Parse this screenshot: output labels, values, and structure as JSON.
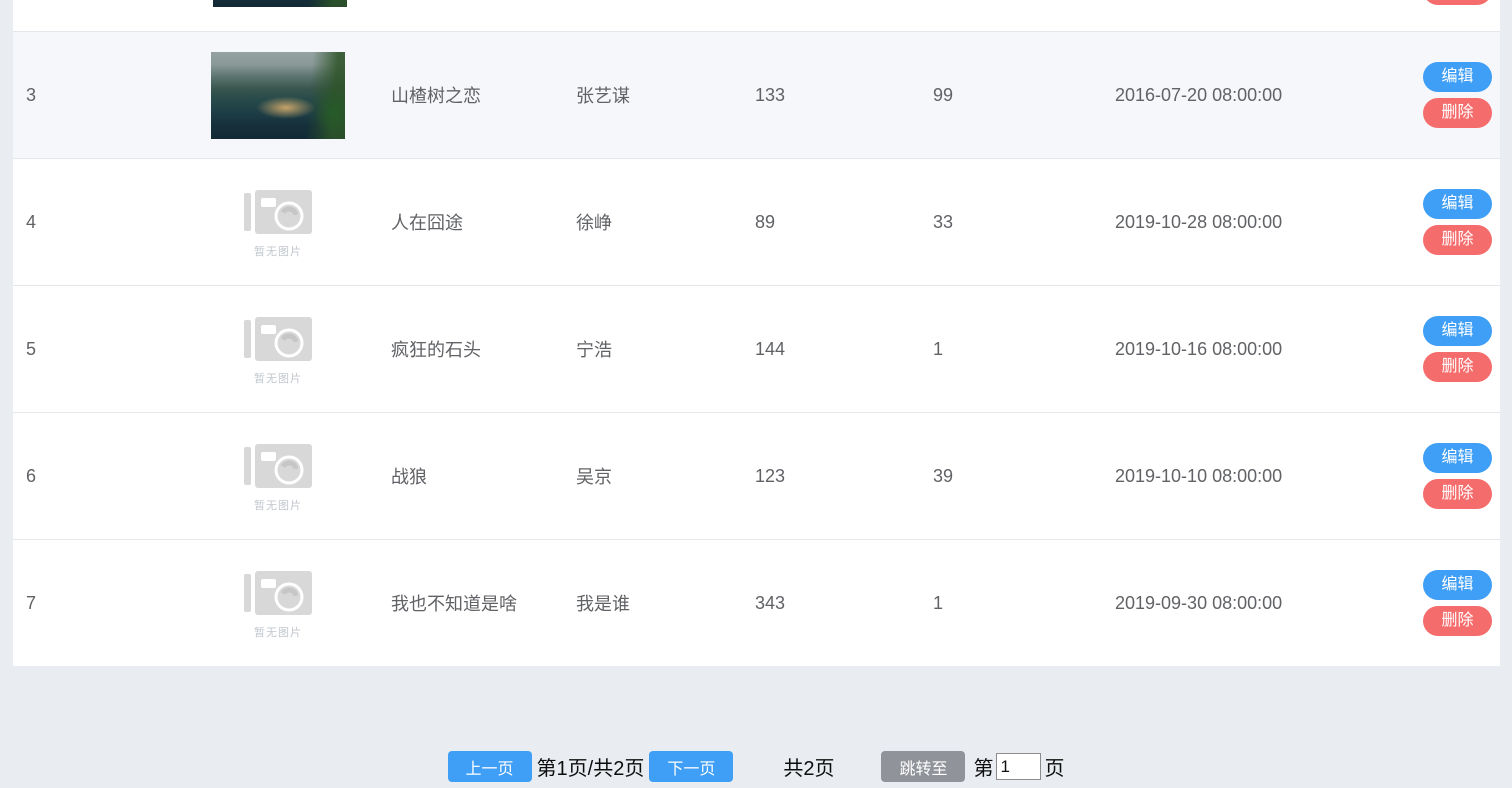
{
  "colors": {
    "page_bg": "#e9edf1",
    "table_bg": "#ffffff",
    "row_highlight_bg": "#f5f7fa",
    "row_border": "#e4e7ec",
    "cell_text": "#606266",
    "primary_blue": "#3f9ef5",
    "danger_red": "#f56c6c",
    "info_gray": "#909399",
    "placeholder_icon_gray": "#d8d8d8",
    "placeholder_text_gray": "#c2c7ce"
  },
  "icons": {
    "no_image": "camera-icon"
  },
  "image_placeholder_label": "暂无图片",
  "actions": {
    "edit_label": "编辑",
    "delete_label": "删除"
  },
  "table": {
    "rows": [
      {
        "id": "3",
        "title": "山楂树之恋",
        "director": "张艺谋",
        "num1": "133",
        "num2": "99",
        "datetime": "2016-07-20 08:00:00",
        "image": "photo",
        "highlight": true
      },
      {
        "id": "4",
        "title": "人在囧途",
        "director": "徐峥",
        "num1": "89",
        "num2": "33",
        "datetime": "2019-10-28 08:00:00",
        "image": "placeholder",
        "highlight": false
      },
      {
        "id": "5",
        "title": "疯狂的石头",
        "director": "宁浩",
        "num1": "144",
        "num2": "1",
        "datetime": "2019-10-16 08:00:00",
        "image": "placeholder",
        "highlight": false
      },
      {
        "id": "6",
        "title": "战狼",
        "director": "吴京",
        "num1": "123",
        "num2": "39",
        "datetime": "2019-10-10 08:00:00",
        "image": "placeholder",
        "highlight": false
      },
      {
        "id": "7",
        "title": "我也不知道是啥",
        "director": "我是谁",
        "num1": "343",
        "num2": "1",
        "datetime": "2019-09-30 08:00:00",
        "image": "placeholder",
        "highlight": false
      }
    ]
  },
  "pagination": {
    "prev_label": "上一页",
    "page_info": "第1页/共2页",
    "next_label": "下一页",
    "total_label": "共2页",
    "jump_label": "跳转至",
    "jump_prefix": "第",
    "jump_value": "1",
    "jump_suffix": "页"
  }
}
